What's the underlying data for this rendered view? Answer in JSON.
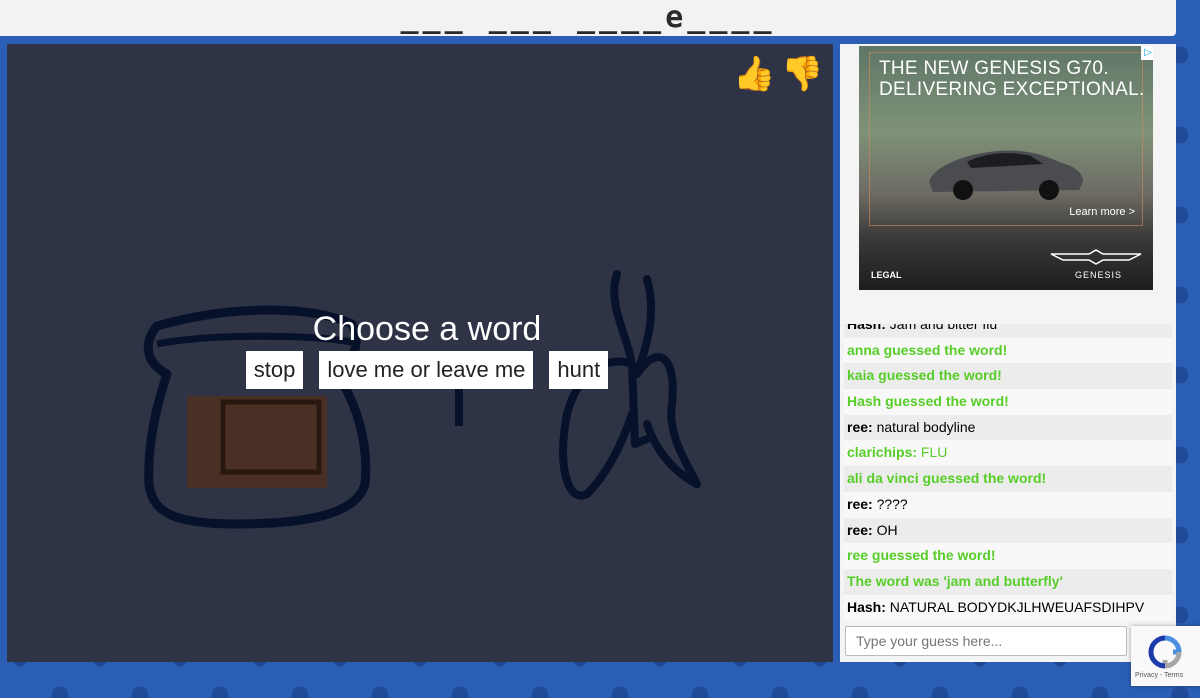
{
  "word_hint": "___ ___ ____e____",
  "prompt": {
    "title": "Choose a word",
    "choices": [
      "stop",
      "love me or leave me",
      "hunt"
    ]
  },
  "rating": {
    "up_icon": "thumbs-up-icon",
    "down_icon": "thumbs-down-icon"
  },
  "ad": {
    "headline_1": "THE NEW GENESIS G70.",
    "headline_2": "DELIVERING EXCEPTIONAL.",
    "learn_more": "Learn more >",
    "legal": "LEGAL",
    "brand": "GENESIS",
    "info_icon": "▷",
    "close_icon": "✕"
  },
  "chat": {
    "messages": [
      {
        "who": "Hash:",
        "text": "Jam and bitter flu",
        "type": "user"
      },
      {
        "text": "anna guessed the word!",
        "type": "system"
      },
      {
        "text": "kaia guessed the word!",
        "type": "system"
      },
      {
        "text": "Hash guessed the word!",
        "type": "system"
      },
      {
        "who": "ree:",
        "text": "natural bodyline",
        "type": "user"
      },
      {
        "who": "clarichips:",
        "text": "FLU",
        "type": "close"
      },
      {
        "text": "ali da vinci guessed the word!",
        "type": "system"
      },
      {
        "who": "ree:",
        "text": "????",
        "type": "user"
      },
      {
        "who": "ree:",
        "text": "OH",
        "type": "user"
      },
      {
        "text": "ree guessed the word!",
        "type": "system"
      },
      {
        "text": "The word was 'jam and butterfly'",
        "type": "system"
      },
      {
        "who": "Hash:",
        "text": "NATURAL BODYDKJLHWEUAFSDIHPV",
        "type": "user"
      }
    ],
    "input_placeholder": "Type your guess here..."
  },
  "recaptcha": {
    "text": "Privacy - Terms"
  },
  "colors": {
    "canvas": "#2e3446",
    "correct": "#56ce27",
    "background": "#2b5fb5"
  }
}
